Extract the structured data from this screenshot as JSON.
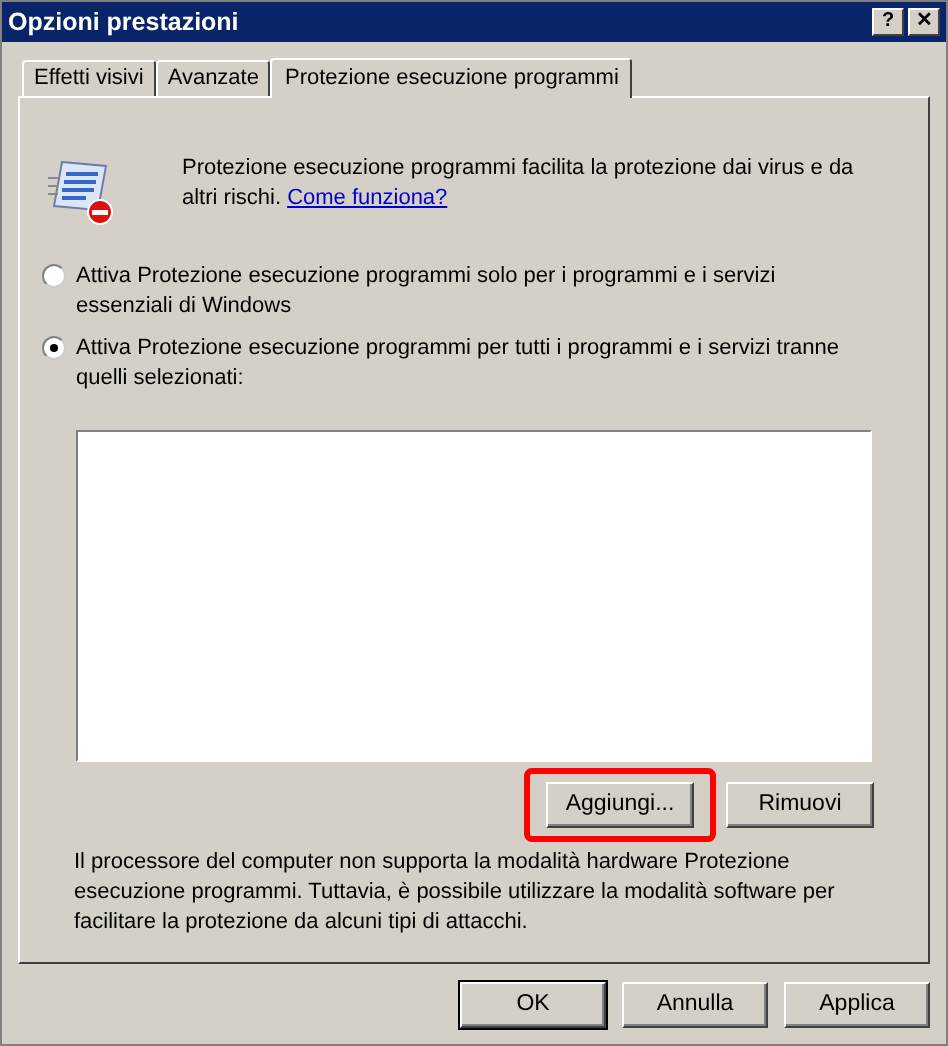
{
  "window": {
    "title": "Opzioni prestazioni",
    "buttons": [
      "?",
      "✕"
    ]
  },
  "tabs": [
    {
      "label": "Effetti visivi",
      "selected": false
    },
    {
      "label": "Avanzate",
      "selected": false
    },
    {
      "label": "Protezione esecuzione programmi",
      "selected": true
    }
  ],
  "intro": {
    "text": "Protezione esecuzione programmi facilita la protezione dai virus e da altri rischi.",
    "link": "Come funziona?"
  },
  "options": [
    {
      "label": "Attiva Protezione esecuzione programmi solo per i programmi e i servizi essenziali di Windows",
      "selected": false
    },
    {
      "label": "Attiva Protezione esecuzione programmi per tutti i programmi e i servizi tranne quelli selezionati:",
      "selected": true
    }
  ],
  "list_buttons": [
    {
      "label": "Aggiungi...",
      "highlighted": true
    },
    {
      "label": "Rimuovi",
      "highlighted": false
    }
  ],
  "note": "Il processore del computer non supporta la modalità hardware Protezione esecuzione programmi. Tuttavia, è possibile utilizzare la modalità software per facilitare la protezione da alcuni tipi di attacchi.",
  "dialog_buttons": [
    "OK",
    "Annulla",
    "Applica"
  ]
}
